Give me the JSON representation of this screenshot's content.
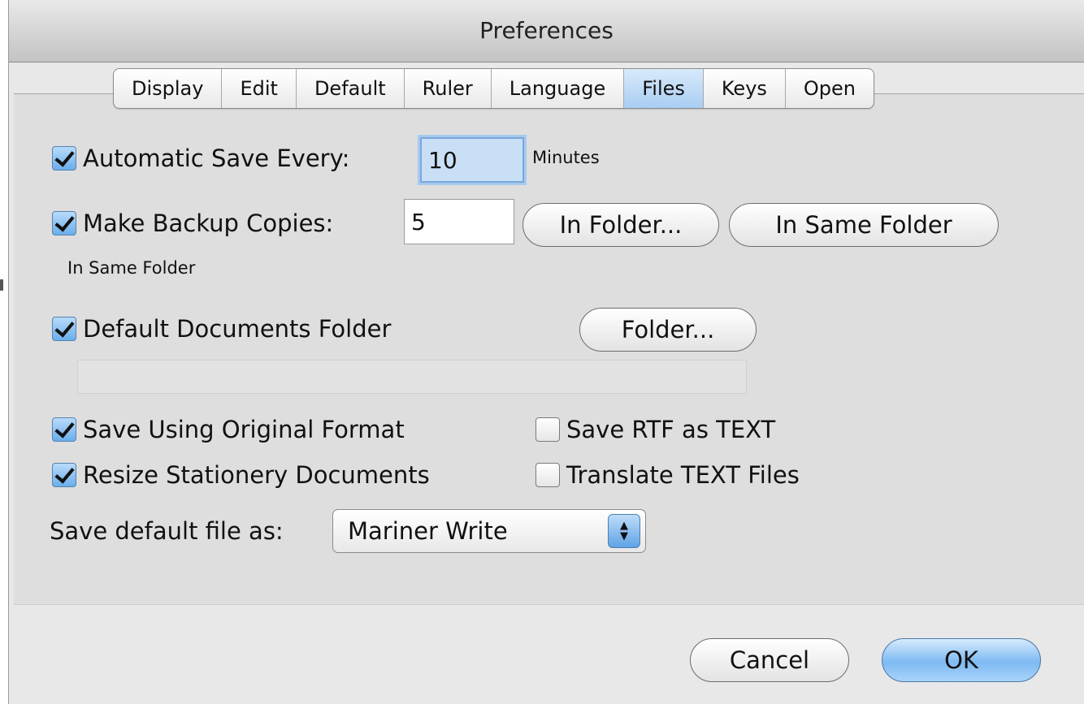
{
  "window": {
    "title": "Preferences"
  },
  "tabs": [
    {
      "label": "Display"
    },
    {
      "label": "Edit"
    },
    {
      "label": "Default"
    },
    {
      "label": "Ruler"
    },
    {
      "label": "Language"
    },
    {
      "label": "Files",
      "active": true
    },
    {
      "label": "Keys"
    },
    {
      "label": "Open"
    }
  ],
  "autosave": {
    "label": "Automatic Save Every:",
    "checked": true,
    "value": "10",
    "unit": "Minutes"
  },
  "backup": {
    "label": "Make Backup Copies:",
    "checked": true,
    "value": "5",
    "in_folder_button": "In Folder...",
    "same_folder_button": "In Same Folder",
    "location_note": "In Same Folder"
  },
  "default_docs": {
    "label": "Default Documents Folder",
    "checked": true,
    "folder_button": "Folder...",
    "path": ""
  },
  "options": {
    "save_original_format": {
      "label": "Save Using Original Format",
      "checked": true
    },
    "resize_stationery": {
      "label": "Resize Stationery Documents",
      "checked": true
    },
    "save_rtf_as_text": {
      "label": "Save RTF as TEXT",
      "checked": false
    },
    "translate_text_files": {
      "label": "Translate TEXT Files",
      "checked": false
    }
  },
  "save_default": {
    "label": "Save default file as:",
    "selected": "Mariner Write"
  },
  "footer": {
    "cancel_label": "Cancel",
    "ok_label": "OK"
  },
  "icons": {
    "checkbox_checked": "checkmark-icon",
    "popup_arrows": "up-down-arrows-icon"
  }
}
